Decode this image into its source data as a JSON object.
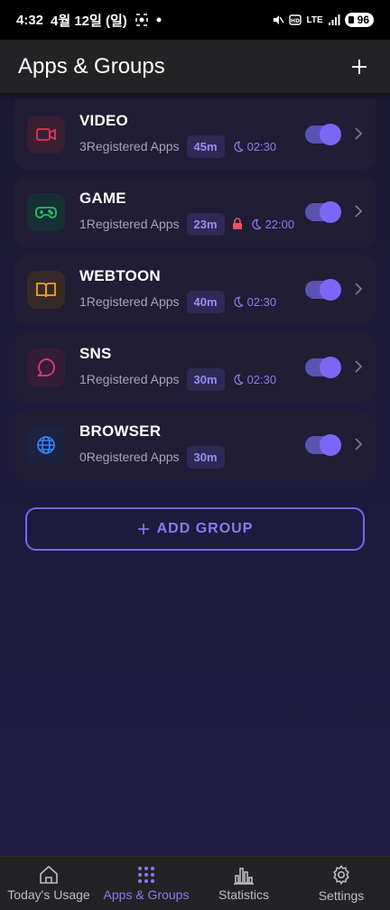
{
  "status_bar": {
    "time": "4:32",
    "date": "4월 12일 (일)",
    "network": "LTE",
    "battery": "96"
  },
  "header": {
    "title": "Apps & Groups"
  },
  "groups": [
    {
      "name": "VIDEO",
      "registered": "3Registered Apps",
      "limit": "45m",
      "sleep_time": "02:30",
      "locked": false,
      "enabled": true,
      "icon": "video-camera-icon",
      "color": "#e0385a",
      "bg": "#3a1e33"
    },
    {
      "name": "GAME",
      "registered": "1Registered Apps",
      "limit": "23m",
      "sleep_time": "22:00",
      "locked": true,
      "enabled": true,
      "icon": "gamepad-icon",
      "color": "#23c26b",
      "bg": "#163034"
    },
    {
      "name": "WEBTOON",
      "registered": "1Registered Apps",
      "limit": "40m",
      "sleep_time": "02:30",
      "locked": false,
      "enabled": true,
      "icon": "book-icon",
      "color": "#f0a020",
      "bg": "#352a27"
    },
    {
      "name": "SNS",
      "registered": "1Registered Apps",
      "limit": "30m",
      "sleep_time": "02:30",
      "locked": false,
      "enabled": true,
      "icon": "chat-bubble-icon",
      "color": "#e6377f",
      "bg": "#351d3a"
    },
    {
      "name": "BROWSER",
      "registered": "0Registered Apps",
      "limit": "30m",
      "sleep_time": "",
      "locked": false,
      "enabled": true,
      "icon": "globe-icon",
      "color": "#3b82f6",
      "bg": "#1b2340"
    }
  ],
  "add_group_label": "ADD GROUP",
  "nav": {
    "today": "Today's Usage",
    "apps": "Apps & Groups",
    "stats": "Statistics",
    "settings": "Settings"
  },
  "colors": {
    "accent": "#8b7af0",
    "lock": "#ef4f5f"
  }
}
